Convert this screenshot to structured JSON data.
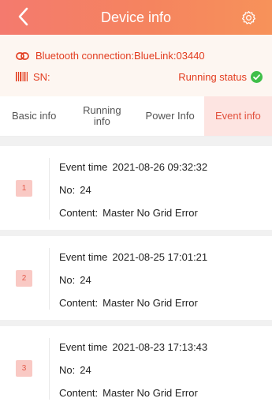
{
  "header": {
    "title": "Device info"
  },
  "device": {
    "bluetooth": "Bluetooth connection:BlueLink:03440",
    "sn": "SN:",
    "status": "Running status"
  },
  "tabs": [
    {
      "line1": "Basic info",
      "line2": ""
    },
    {
      "line1": "Running",
      "line2": "info"
    },
    {
      "line1": "Power Info",
      "line2": ""
    },
    {
      "line1": "Event info",
      "line2": ""
    }
  ],
  "events": [
    {
      "index": "1",
      "time_label": "Event time",
      "time": "2021-08-26 09:32:32",
      "no_label": "No:",
      "no": "24",
      "content_label": "Content:",
      "content": "Master No Grid Error"
    },
    {
      "index": "2",
      "time_label": "Event time",
      "time": "2021-08-25 17:01:21",
      "no_label": "No:",
      "no": "24",
      "content_label": "Content:",
      "content": "Master No Grid Error"
    },
    {
      "index": "3",
      "time_label": "Event time",
      "time": "2021-08-23 17:13:43",
      "no_label": "No:",
      "no": "24",
      "content_label": "Content:",
      "content": "Master No Grid Error"
    }
  ],
  "colors": {
    "accent": "#f47a6e",
    "status_ok": "#3fbf4a",
    "tab_active_bg": "#fde4e1"
  }
}
